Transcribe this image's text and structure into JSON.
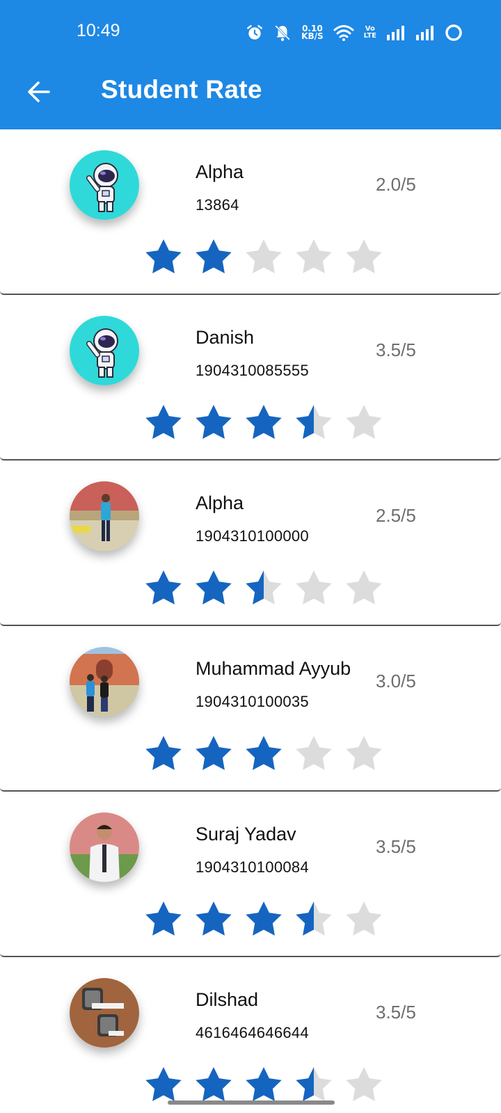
{
  "status_bar": {
    "time": "10:49",
    "speed_value": "0.10",
    "speed_unit": "KB/S",
    "volte_top": "Vo",
    "volte_bottom": "LTE"
  },
  "app_bar": {
    "title": "Student Rate",
    "back_icon": "arrow-back-icon",
    "color": "#1E88E5"
  },
  "rating": {
    "max": 5,
    "filled_color": "#1565C0",
    "empty_color": "#DCDCDC"
  },
  "students": [
    {
      "name": "Alpha",
      "roll": "13864",
      "score_text": "2.0/5",
      "rating": 2.0,
      "avatar": "astronaut-avatar"
    },
    {
      "name": "Danish",
      "roll": "1904310085555",
      "score_text": "3.5/5",
      "rating": 3.5,
      "avatar": "astronaut-avatar"
    },
    {
      "name": "Alpha",
      "roll": "1904310100000",
      "score_text": "2.5/5",
      "rating": 2.5,
      "avatar": "photo-avatar-single-person"
    },
    {
      "name": "Muhammad Ayyub",
      "roll": "1904310100035",
      "score_text": "3.0/5",
      "rating": 3.0,
      "avatar": "photo-avatar-two-people"
    },
    {
      "name": "Suraj Yadav",
      "roll": "1904310100084",
      "score_text": "3.5/5",
      "rating": 3.5,
      "avatar": "photo-avatar-person-portrait"
    },
    {
      "name": "Dilshad",
      "roll": "4616464646644",
      "score_text": "3.5/5",
      "rating": 3.5,
      "avatar": "photo-avatar-watches"
    }
  ]
}
